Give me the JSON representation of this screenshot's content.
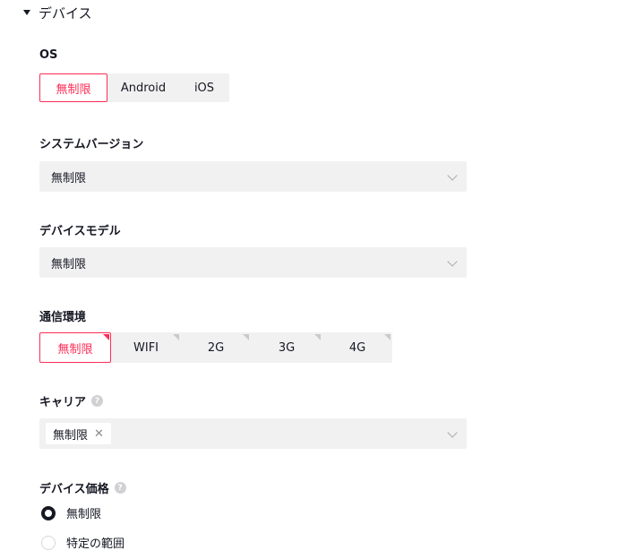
{
  "section": {
    "title": "デバイス"
  },
  "os": {
    "label": "OS",
    "options": [
      "無制限",
      "Android",
      "iOS"
    ],
    "selected": "無制限"
  },
  "system_version": {
    "label": "システムバージョン",
    "value": "無制限"
  },
  "device_model": {
    "label": "デバイスモデル",
    "value": "無制限"
  },
  "network": {
    "label": "通信環境",
    "options": [
      "無制限",
      "WIFI",
      "2G",
      "3G",
      "4G"
    ],
    "selected": "無制限"
  },
  "carrier": {
    "label": "キャリア",
    "tag": "無制限",
    "tag_close": "✕"
  },
  "device_price": {
    "label": "デバイス価格",
    "options": [
      "無制限",
      "特定の範囲"
    ],
    "selected": "無制限"
  },
  "help_glyph": "?",
  "colors": {
    "accent": "#fe2c55",
    "field_bg": "#f1f1f2",
    "text": "#161823"
  }
}
